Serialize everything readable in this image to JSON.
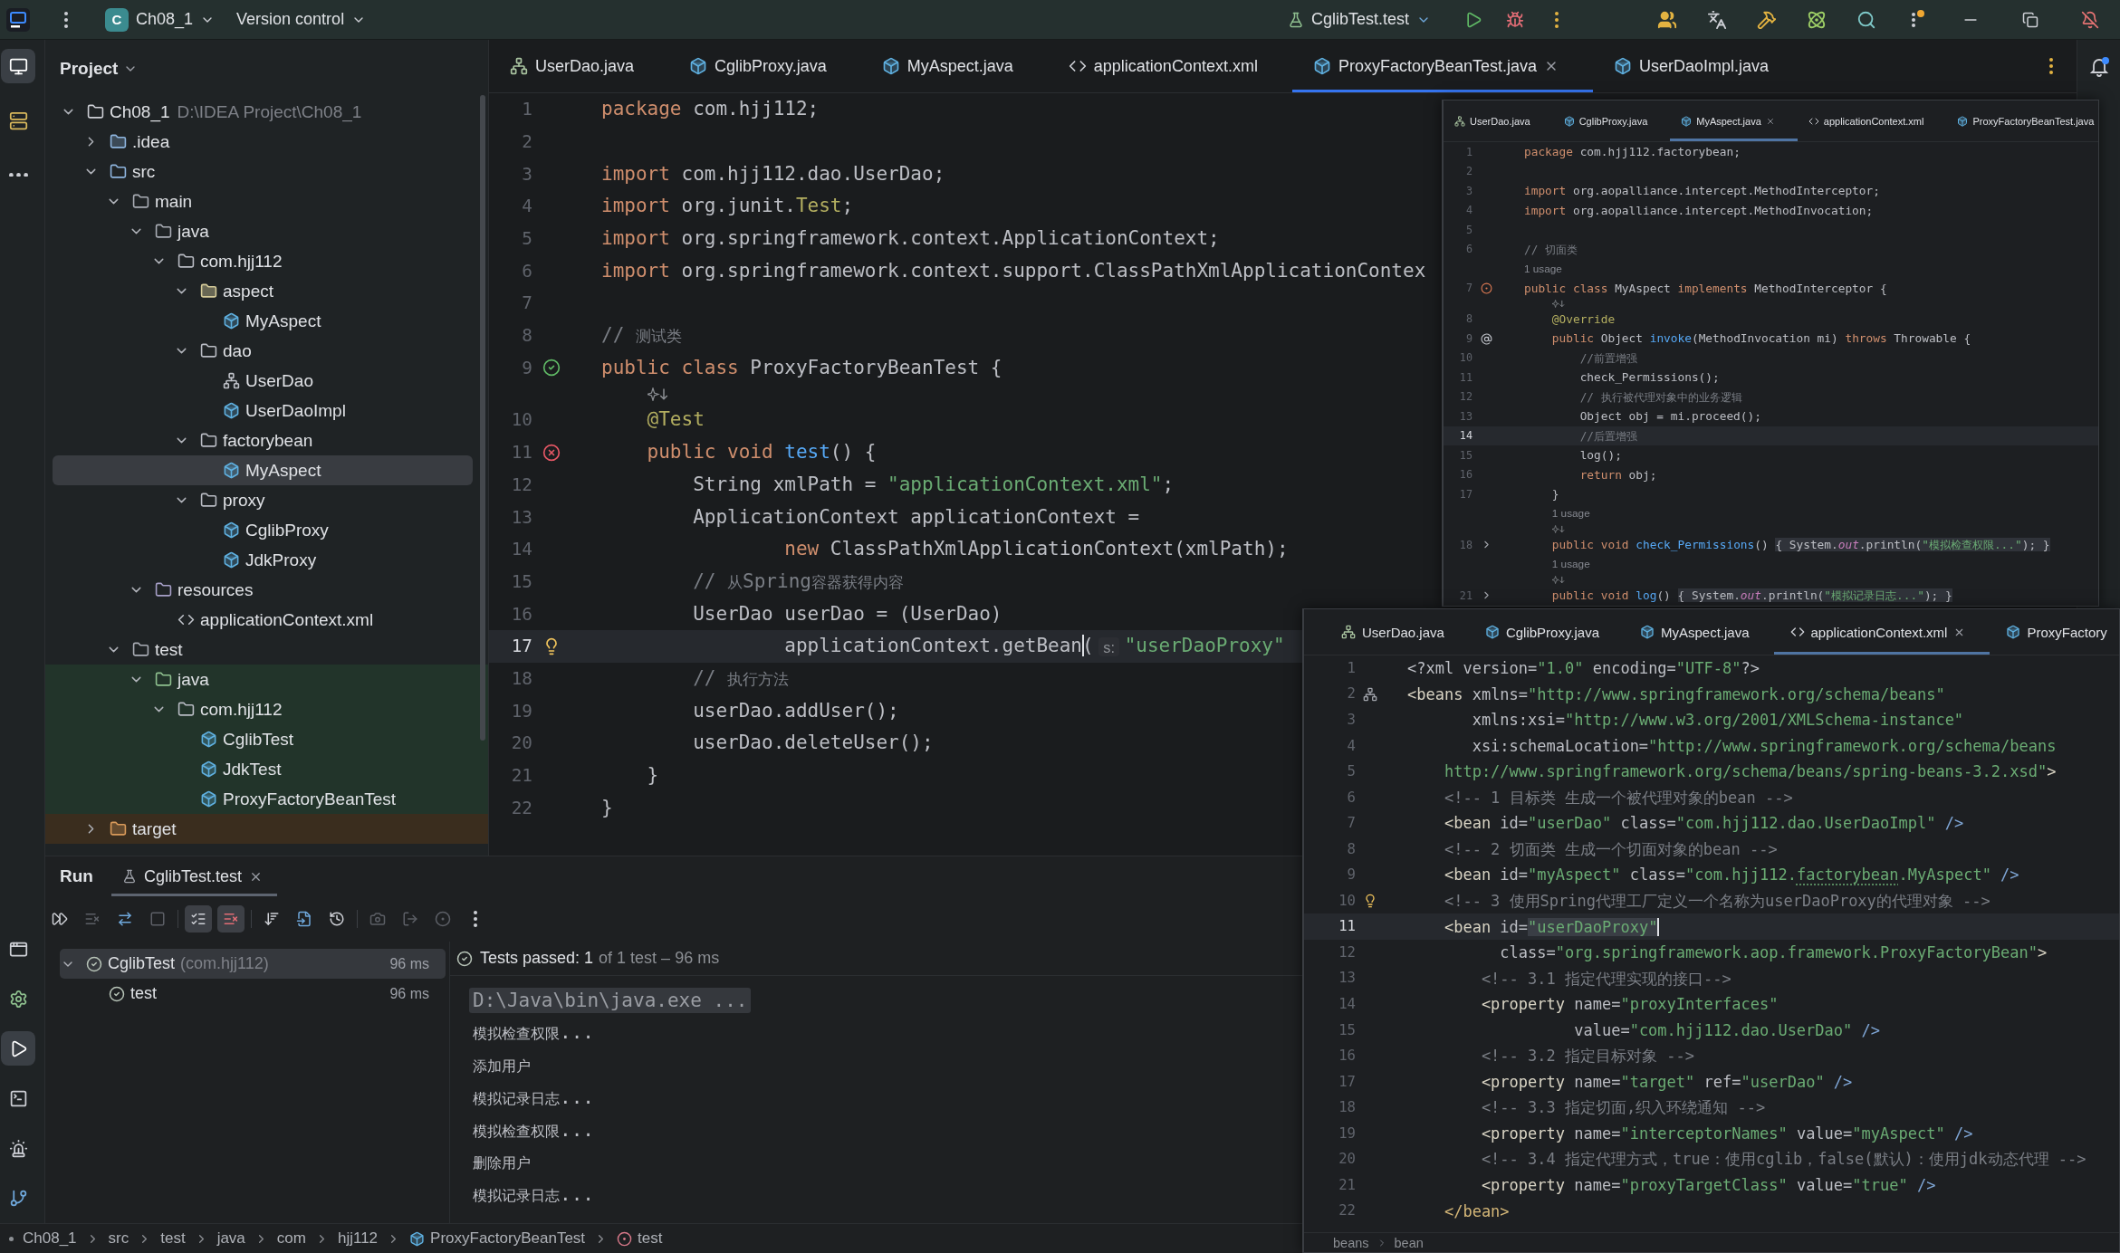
{
  "title_bar": {
    "project_badge": "C",
    "project": "Ch08_1",
    "vcs": "Version control",
    "run_config": "CglibTest.test"
  },
  "tool_strip": {
    "top": [
      {
        "kind": "project",
        "selected": true
      },
      {
        "kind": "structure",
        "selected": false
      },
      {
        "kind": "more",
        "selected": false
      }
    ],
    "bottom": [
      {
        "kind": "layout",
        "selected": false
      },
      {
        "kind": "services",
        "selected": false
      },
      {
        "kind": "run",
        "selected": true
      },
      {
        "kind": "terminal",
        "selected": false
      },
      {
        "kind": "problems",
        "selected": false
      },
      {
        "kind": "git",
        "selected": false
      }
    ]
  },
  "project_panel": {
    "title": "Project",
    "tree": [
      {
        "name": "Ch08_1",
        "kind": "module",
        "path": "D:\\IDEA Project\\Ch08_1",
        "expanded": true,
        "selected": false,
        "children": [
          {
            "name": ".idea",
            "kind": "config_folder",
            "expanded": false,
            "selected": false
          },
          {
            "name": "src",
            "kind": "source_folder",
            "expanded": true,
            "selected": false,
            "children": [
              {
                "name": "main",
                "kind": "folder",
                "expanded": true,
                "selected": false,
                "children": [
                  {
                    "name": "java",
                    "kind": "source_root",
                    "expanded": true,
                    "selected": false,
                    "children": [
                      {
                        "name": "com.hjj112",
                        "kind": "package",
                        "expanded": true,
                        "selected": false,
                        "children": [
                          {
                            "name": "aspect",
                            "kind": "plain_folder",
                            "expanded": true,
                            "selected": false,
                            "children": [
                              {
                                "name": "MyAspect",
                                "kind": "class",
                                "selected": false
                              }
                            ]
                          },
                          {
                            "name": "dao",
                            "kind": "package",
                            "expanded": true,
                            "selected": false,
                            "children": [
                              {
                                "name": "UserDao",
                                "kind": "interface",
                                "selected": false
                              },
                              {
                                "name": "UserDaoImpl",
                                "kind": "class",
                                "selected": false
                              }
                            ]
                          },
                          {
                            "name": "factorybean",
                            "kind": "package",
                            "expanded": true,
                            "selected": false,
                            "children": [
                              {
                                "name": "MyAspect",
                                "kind": "class",
                                "selected": true
                              }
                            ]
                          },
                          {
                            "name": "proxy",
                            "kind": "package",
                            "expanded": true,
                            "selected": false,
                            "children": [
                              {
                                "name": "CglibProxy",
                                "kind": "class",
                                "selected": false
                              },
                              {
                                "name": "JdkProxy",
                                "kind": "class",
                                "selected": false
                              }
                            ]
                          }
                        ]
                      }
                    ]
                  },
                  {
                    "name": "resources",
                    "kind": "resource_root",
                    "expanded": true,
                    "selected": false,
                    "children": [
                      {
                        "name": "applicationContext.xml",
                        "kind": "xml",
                        "selected": false
                      }
                    ]
                  }
                ]
              },
              {
                "name": "test",
                "kind": "folder",
                "expanded": true,
                "selected": false,
                "children": [
                  {
                    "name": "java",
                    "kind": "test_root",
                    "expanded": true,
                    "selected": false,
                    "children": [
                      {
                        "name": "com.hjj112",
                        "kind": "test_package",
                        "expanded": true,
                        "selected": false,
                        "children": [
                          {
                            "name": "CglibTest",
                            "kind": "test_class",
                            "selected": false
                          },
                          {
                            "name": "JdkTest",
                            "kind": "test_class",
                            "selected": false
                          },
                          {
                            "name": "ProxyFactoryBeanTest",
                            "kind": "test_class",
                            "selected": false
                          }
                        ]
                      }
                    ]
                  }
                ]
              }
            ]
          },
          {
            "name": "target",
            "kind": "excluded_folder",
            "expanded": false,
            "selected": false
          }
        ]
      }
    ]
  },
  "editor": {
    "tabs": [
      {
        "label": "UserDao.java",
        "kind": "interface",
        "selected": false
      },
      {
        "label": "CglibProxy.java",
        "kind": "class",
        "selected": false
      },
      {
        "label": "MyAspect.java",
        "kind": "class",
        "selected": false
      },
      {
        "label": "applicationContext.xml",
        "kind": "xml",
        "selected": false
      },
      {
        "label": "ProxyFactoryBeanTest.java",
        "kind": "class",
        "selected": true
      },
      {
        "label": "UserDaoImpl.java",
        "kind": "class",
        "selected": false
      }
    ],
    "lines": [
      {
        "number": "1",
        "current": false,
        "tokens": [
          {
            "kind": "kw",
            "text": "package"
          },
          {
            "kind": "p",
            "text": " com.hjj112;"
          }
        ]
      },
      {
        "number": "2",
        "current": false
      },
      {
        "number": "3",
        "current": false,
        "tokens": [
          {
            "kind": "kw",
            "text": "import"
          },
          {
            "kind": "p",
            "text": " com.hjj112.dao.UserDao;"
          }
        ]
      },
      {
        "number": "4",
        "current": false,
        "tokens": [
          {
            "kind": "kw",
            "text": "import"
          },
          {
            "kind": "p",
            "text": " org.junit."
          },
          {
            "kind": "ann",
            "text": "Test"
          },
          {
            "kind": "p",
            "text": ";"
          }
        ]
      },
      {
        "number": "5",
        "current": false,
        "tokens": [
          {
            "kind": "kw",
            "text": "import"
          },
          {
            "kind": "p",
            "text": " org.springframework.context.ApplicationContext;"
          }
        ]
      },
      {
        "number": "6",
        "current": false,
        "tokens": [
          {
            "kind": "kw",
            "text": "import"
          },
          {
            "kind": "p",
            "text": " org.springframework.context.support.ClassPathXmlApplicationContex"
          }
        ]
      },
      {
        "number": "7",
        "current": false
      },
      {
        "number": "8",
        "current": false,
        "tokens": [
          {
            "kind": "cmt",
            "text": "// 测试类"
          }
        ]
      },
      {
        "number": "9",
        "current": false,
        "marker": {
          "kind": "passed"
        },
        "tokens": [
          {
            "kind": "kw",
            "text": "public class"
          },
          {
            "kind": "p",
            "text": " ProxyFactoryBeanTest {"
          }
        ]
      },
      {
        "number": "10",
        "current": false,
        "above": [
          {
            "kind": "ai"
          }
        ],
        "tokens": [
          {
            "kind": "ann",
            "text": "    @Test"
          }
        ]
      },
      {
        "number": "11",
        "current": false,
        "marker": {
          "kind": "failed"
        },
        "tokens": [
          {
            "kind": "kw",
            "text": "    public void"
          },
          {
            "kind": "fn",
            "text": " test"
          },
          {
            "kind": "p",
            "text": "() {"
          }
        ]
      },
      {
        "number": "12",
        "current": false,
        "tokens": [
          {
            "kind": "p",
            "text": "        String xmlPath = "
          },
          {
            "kind": "str",
            "text": "\"applicationContext.xml\""
          },
          {
            "kind": "p",
            "text": ";"
          }
        ]
      },
      {
        "number": "13",
        "current": false,
        "tokens": [
          {
            "kind": "p",
            "text": "        ApplicationContext applicationContext ="
          }
        ]
      },
      {
        "number": "14",
        "current": false,
        "tokens": [
          {
            "kind": "kw",
            "text": "                new"
          },
          {
            "kind": "p",
            "text": " ClassPathXmlApplicationContext(xmlPath);"
          }
        ]
      },
      {
        "number": "15",
        "current": false,
        "tokens": [
          {
            "kind": "cmt",
            "text": "        // 从Spring容器获得内容"
          }
        ]
      },
      {
        "number": "16",
        "current": false,
        "tokens": [
          {
            "kind": "p",
            "text": "        UserDao userDao = (UserDao)"
          }
        ]
      },
      {
        "number": "17",
        "current": true,
        "marker": {
          "kind": "bulb"
        },
        "tokens": [
          {
            "kind": "p",
            "text": "                applicationContext.getBean"
          },
          {
            "kind": "caret"
          },
          {
            "kind": "p",
            "text": "("
          },
          {
            "kind": "hint",
            "text": "s:"
          },
          {
            "kind": "str",
            "text": "\"userDaoProxy\""
          }
        ]
      },
      {
        "number": "18",
        "current": false,
        "tokens": [
          {
            "kind": "cmt",
            "text": "        // 执行方法"
          }
        ]
      },
      {
        "number": "19",
        "current": false,
        "tokens": [
          {
            "kind": "p",
            "text": "        userDao.addUser();"
          }
        ]
      },
      {
        "number": "20",
        "current": false,
        "tokens": [
          {
            "kind": "p",
            "text": "        userDao.deleteUser();"
          }
        ]
      },
      {
        "number": "21",
        "current": false,
        "tokens": [
          {
            "kind": "p",
            "text": "    }"
          }
        ]
      },
      {
        "number": "22",
        "current": false,
        "tokens": [
          {
            "kind": "p",
            "text": "}"
          }
        ]
      }
    ]
  },
  "overlay_windows": [
    {
      "tabs": [
        {
          "label": "UserDao.java",
          "kind": "interface",
          "selected": false
        },
        {
          "label": "CglibProxy.java",
          "kind": "class",
          "selected": false
        },
        {
          "label": "MyAspect.java",
          "kind": "class",
          "selected": true
        },
        {
          "label": "applicationContext.xml",
          "kind": "xml",
          "selected": false
        },
        {
          "label": "ProxyFactoryBeanTest.java",
          "kind": "class",
          "selected": false
        }
      ],
      "lines": [
        {
          "number": "1",
          "current": false,
          "tokens": [
            {
              "kind": "kw",
              "text": "package"
            },
            {
              "kind": "p",
              "text": " com.hjj112.factorybean;"
            }
          ]
        },
        {
          "number": "2",
          "current": false
        },
        {
          "number": "3",
          "current": false,
          "tokens": [
            {
              "kind": "kw",
              "text": "import"
            },
            {
              "kind": "p",
              "text": " org.aopalliance.intercept.MethodInterceptor;"
            }
          ]
        },
        {
          "number": "4",
          "current": false,
          "tokens": [
            {
              "kind": "kw",
              "text": "import"
            },
            {
              "kind": "p",
              "text": " org.aopalliance.intercept.MethodInvocation;"
            }
          ]
        },
        {
          "number": "5",
          "current": false
        },
        {
          "number": "6",
          "current": false,
          "tokens": [
            {
              "kind": "cmt",
              "text": "// 切面类"
            }
          ]
        },
        {
          "number": "7",
          "current": false,
          "marker": {
            "kind": "implements"
          },
          "above": [
            {
              "kind": "usage",
              "text": "1 usage"
            }
          ],
          "tokens": [
            {
              "kind": "kw",
              "text": "public class"
            },
            {
              "kind": "p",
              "text": " MyAspect "
            },
            {
              "kind": "kw",
              "text": "implements"
            },
            {
              "kind": "p",
              "text": " MethodInterceptor {"
            }
          ]
        },
        {
          "number": "8",
          "current": false,
          "above": [
            {
              "kind": "ai"
            }
          ],
          "tokens": [
            {
              "kind": "ann",
              "text": "    @Override"
            }
          ]
        },
        {
          "number": "9",
          "current": false,
          "marker": {
            "kind": "override"
          },
          "tokens": [
            {
              "kind": "kw",
              "text": "    public"
            },
            {
              "kind": "p",
              "text": " Object "
            },
            {
              "kind": "fn",
              "text": "invoke"
            },
            {
              "kind": "p",
              "text": "(MethodInvocation mi) "
            },
            {
              "kind": "kw",
              "text": "throws"
            },
            {
              "kind": "p",
              "text": " Throwable {"
            }
          ]
        },
        {
          "number": "10",
          "current": false,
          "tokens": [
            {
              "kind": "cmt",
              "text": "        //前置增强"
            }
          ]
        },
        {
          "number": "11",
          "current": false,
          "tokens": [
            {
              "kind": "p",
              "text": "        check_Permissions();"
            }
          ]
        },
        {
          "number": "12",
          "current": false,
          "tokens": [
            {
              "kind": "cmt",
              "text": "        // 执行被代理对象中的业务逻辑"
            }
          ]
        },
        {
          "number": "13",
          "current": false,
          "tokens": [
            {
              "kind": "p",
              "text": "        Object obj = mi.proceed();"
            }
          ]
        },
        {
          "number": "14",
          "current": true,
          "tokens": [
            {
              "kind": "cmt",
              "text": "        //后置增强"
            }
          ]
        },
        {
          "number": "15",
          "current": false,
          "tokens": [
            {
              "kind": "p",
              "text": "        log();"
            }
          ]
        },
        {
          "number": "16",
          "current": false,
          "tokens": [
            {
              "kind": "kw",
              "text": "        return"
            },
            {
              "kind": "p",
              "text": " obj;"
            }
          ]
        },
        {
          "number": "17",
          "current": false,
          "tokens": [
            {
              "kind": "p",
              "text": "    }"
            }
          ]
        },
        {
          "number": "18",
          "current": false,
          "marker": {
            "kind": "fold"
          },
          "above": [
            {
              "kind": "usage",
              "text": "1 usage"
            },
            {
              "kind": "ai"
            }
          ],
          "tokens": [
            {
              "kind": "kw",
              "text": "    public void"
            },
            {
              "kind": "fn",
              "text": " check_Permissions"
            },
            {
              "kind": "p",
              "text": "() "
            },
            {
              "kind": "fp",
              "text": "{ System."
            },
            {
              "kind": "fst",
              "text": "out"
            },
            {
              "kind": "fp",
              "text": ".println("
            },
            {
              "kind": "fstr",
              "text": "\"模拟检查权限...\""
            },
            {
              "kind": "fp",
              "text": "); }"
            }
          ]
        },
        {
          "number": "21",
          "current": false,
          "marker": {
            "kind": "fold"
          },
          "above": [
            {
              "kind": "usage",
              "text": "1 usage"
            },
            {
              "kind": "ai"
            }
          ],
          "tokens": [
            {
              "kind": "kw",
              "text": "    public void"
            },
            {
              "kind": "fn",
              "text": " log"
            },
            {
              "kind": "p",
              "text": "() "
            },
            {
              "kind": "fp",
              "text": "{ System."
            },
            {
              "kind": "fst",
              "text": "out"
            },
            {
              "kind": "fp",
              "text": ".println("
            },
            {
              "kind": "fstr",
              "text": "\"模拟记录日志...\""
            },
            {
              "kind": "fp",
              "text": "); }"
            }
          ]
        }
      ]
    },
    {
      "tabs": [
        {
          "label": "UserDao.java",
          "kind": "interface",
          "selected": false
        },
        {
          "label": "CglibProxy.java",
          "kind": "class",
          "selected": false
        },
        {
          "label": "MyAspect.java",
          "kind": "class",
          "selected": false
        },
        {
          "label": "applicationContext.xml",
          "kind": "xml",
          "selected": true
        },
        {
          "label": "ProxyFactory",
          "kind": "class",
          "selected": false
        }
      ],
      "lines": [
        {
          "number": "1",
          "current": false,
          "tokens": [
            {
              "kind": "p",
              "text": "<?xml version="
            },
            {
              "kind": "str",
              "text": "\"1.0\""
            },
            {
              "kind": "p",
              "text": " encoding="
            },
            {
              "kind": "str",
              "text": "\"UTF-8\""
            },
            {
              "kind": "p",
              "text": "?>"
            }
          ]
        },
        {
          "number": "2",
          "current": false,
          "marker": {
            "kind": "structure"
          },
          "tokens": [
            {
              "kind": "tag",
              "text": "<beans"
            },
            {
              "kind": "attr",
              "text": " xmlns="
            },
            {
              "kind": "val",
              "text": "\"http://www.springframework.org/schema/beans\""
            }
          ]
        },
        {
          "number": "3",
          "current": false,
          "tokens": [
            {
              "kind": "attr",
              "text": "       xmlns:xsi="
            },
            {
              "kind": "val",
              "text": "\"http://www.w3.org/2001/XMLSchema-instance\""
            }
          ]
        },
        {
          "number": "4",
          "current": false,
          "tokens": [
            {
              "kind": "attr",
              "text": "       xsi:schemaLocation="
            },
            {
              "kind": "val",
              "text": "\"http://www.springframework.org/schema/beans"
            }
          ]
        },
        {
          "number": "5",
          "current": false,
          "tokens": [
            {
              "kind": "val",
              "text": "    http://www.springframework.org/schema/beans/spring-beans-3.2.xsd\""
            },
            {
              "kind": "tag",
              "text": ">"
            }
          ]
        },
        {
          "number": "6",
          "current": false,
          "tokens": [
            {
              "kind": "cmt",
              "text": "    <!-- 1 目标类 生成一个被代理对象的bean -->"
            }
          ]
        },
        {
          "number": "7",
          "current": false,
          "tokens": [
            {
              "kind": "tag",
              "text": "    <bean"
            },
            {
              "kind": "attr",
              "text": " id="
            },
            {
              "kind": "val",
              "text": "\"userDao\""
            },
            {
              "kind": "attr",
              "text": " class="
            },
            {
              "kind": "val",
              "text": "\"com.hjj112.dao.UserDaoImpl\""
            },
            {
              "kind": "tagend",
              "text": " />"
            }
          ]
        },
        {
          "number": "8",
          "current": false,
          "tokens": [
            {
              "kind": "cmt",
              "text": "    <!-- 2 切面类 生成一个切面对象的bean -->"
            }
          ]
        },
        {
          "number": "9",
          "current": false,
          "tokens": [
            {
              "kind": "tag",
              "text": "    <bean"
            },
            {
              "kind": "attr",
              "text": " id="
            },
            {
              "kind": "val",
              "text": "\"myAspect\""
            },
            {
              "kind": "attr",
              "text": " class="
            },
            {
              "kind": "val",
              "text": "\"com.hjj112."
            },
            {
              "kind": "typo",
              "text": "factorybean"
            },
            {
              "kind": "val",
              "text": ".MyAspect\""
            },
            {
              "kind": "tagend",
              "text": " />"
            }
          ]
        },
        {
          "number": "10",
          "current": false,
          "marker": {
            "kind": "bulb"
          },
          "tokens": [
            {
              "kind": "cmt",
              "text": "    <!-- 3 使用Spring代理工厂定义一个名称为userDaoProxy的代理对象 -->"
            }
          ]
        },
        {
          "number": "11",
          "current": true,
          "tokens": [
            {
              "kind": "tag",
              "text": "    <bean"
            },
            {
              "kind": "attr",
              "text": " id="
            },
            {
              "kind": "valsel",
              "text": "\"userDaoProxy\""
            },
            {
              "kind": "caret"
            }
          ]
        },
        {
          "number": "12",
          "current": false,
          "tokens": [
            {
              "kind": "attr",
              "text": "          class="
            },
            {
              "kind": "val",
              "text": "\"org.springframework.aop.framework.ProxyFactoryBean\""
            },
            {
              "kind": "tag",
              "text": ">"
            }
          ]
        },
        {
          "number": "13",
          "current": false,
          "tokens": [
            {
              "kind": "cmt",
              "text": "        <!-- 3.1 指定代理实现的接口-->"
            }
          ]
        },
        {
          "number": "14",
          "current": false,
          "tokens": [
            {
              "kind": "tag",
              "text": "        <property"
            },
            {
              "kind": "attr",
              "text": " name="
            },
            {
              "kind": "val",
              "text": "\"proxyInterfaces\""
            }
          ]
        },
        {
          "number": "15",
          "current": false,
          "tokens": [
            {
              "kind": "attr",
              "text": "                  value="
            },
            {
              "kind": "val",
              "text": "\"com.hjj112.dao.UserDao\""
            },
            {
              "kind": "tagend",
              "text": " />"
            }
          ]
        },
        {
          "number": "16",
          "current": false,
          "tokens": [
            {
              "kind": "cmt",
              "text": "        <!-- 3.2 指定目标对象 -->"
            }
          ]
        },
        {
          "number": "17",
          "current": false,
          "tokens": [
            {
              "kind": "tag",
              "text": "        <property"
            },
            {
              "kind": "attr",
              "text": " name="
            },
            {
              "kind": "val",
              "text": "\"target\""
            },
            {
              "kind": "attr",
              "text": " ref="
            },
            {
              "kind": "val",
              "text": "\"userDao\""
            },
            {
              "kind": "tagend",
              "text": " />"
            }
          ]
        },
        {
          "number": "18",
          "current": false,
          "tokens": [
            {
              "kind": "cmt",
              "text": "        <!-- 3.3 指定切面,织入环绕通知 -->"
            }
          ]
        },
        {
          "number": "19",
          "current": false,
          "tokens": [
            {
              "kind": "tag",
              "text": "        <property"
            },
            {
              "kind": "attr",
              "text": " name="
            },
            {
              "kind": "val",
              "text": "\"interceptorNames\""
            },
            {
              "kind": "attr",
              "text": " value="
            },
            {
              "kind": "val",
              "text": "\"myAspect\""
            },
            {
              "kind": "tagend",
              "text": " />"
            }
          ]
        },
        {
          "number": "20",
          "current": false,
          "tokens": [
            {
              "kind": "cmt",
              "text": "        <!-- 3.4 指定代理方式，true：使用cglib，false(默认)：使用jdk动态代理 -->"
            }
          ]
        },
        {
          "number": "21",
          "current": false,
          "tokens": [
            {
              "kind": "tag",
              "text": "        <property"
            },
            {
              "kind": "attr",
              "text": " name="
            },
            {
              "kind": "val",
              "text": "\"proxyTargetClass\""
            },
            {
              "kind": "attr",
              "text": " value="
            },
            {
              "kind": "val",
              "text": "\"true\""
            },
            {
              "kind": "tagend",
              "text": " />"
            }
          ]
        },
        {
          "number": "22",
          "current": false,
          "tokens": [
            {
              "kind": "tagm",
              "text": "    </bean>"
            }
          ]
        }
      ],
      "breadcrumbs": [
        {
          "label": "beans"
        },
        {
          "label": "bean"
        }
      ]
    }
  ],
  "run_panel": {
    "title": "Run",
    "tabs": [
      {
        "label": "CglibTest.test",
        "selected": true
      }
    ],
    "toolbar_groups": [
      [
        {
          "kind": "rerun",
          "disabled": false,
          "on": false
        },
        {
          "kind": "rerun_failed",
          "disabled": true,
          "on": false
        },
        {
          "kind": "auto_test",
          "disabled": false,
          "on": false
        },
        {
          "kind": "stop",
          "disabled": true,
          "on": false
        }
      ],
      [
        {
          "kind": "show_passed",
          "disabled": false,
          "on": true
        },
        {
          "kind": "show_ignored",
          "disabled": false,
          "on": true
        }
      ],
      [
        {
          "kind": "sort",
          "disabled": false,
          "on": false
        },
        {
          "kind": "import",
          "disabled": false,
          "on": false
        },
        {
          "kind": "history",
          "disabled": false,
          "on": false
        }
      ],
      [
        {
          "kind": "snapshot",
          "disabled": true,
          "on": false
        },
        {
          "kind": "export",
          "disabled": true,
          "on": false
        },
        {
          "kind": "coverage",
          "disabled": true,
          "on": false
        },
        {
          "kind": "more",
          "disabled": false,
          "on": false
        }
      ]
    ],
    "tests": [
      {
        "name": "CglibTest",
        "package": "(com.hjj112)",
        "time": "96 ms",
        "passed": true,
        "expanded": true,
        "selected": true,
        "children": [
          {
            "name": "test",
            "time": "96 ms",
            "passed": true,
            "selected": false
          }
        ]
      }
    ],
    "summary": {
      "status": "Tests passed: 1",
      "detail": "of 1 test – 96 ms"
    },
    "console": [
      {
        "kind": "command",
        "text": "D:\\Java\\bin\\java.exe ..."
      },
      {
        "kind": "output",
        "text": "模拟检查权限..."
      },
      {
        "kind": "output",
        "text": "添加用户"
      },
      {
        "kind": "output",
        "text": "模拟记录日志..."
      },
      {
        "kind": "output",
        "text": "模拟检查权限..."
      },
      {
        "kind": "output",
        "text": "删除用户"
      },
      {
        "kind": "output",
        "text": "模拟记录日志..."
      }
    ]
  },
  "status_bar": {
    "breadcrumbs": [
      {
        "kind": "folder",
        "label": "Ch08_1"
      },
      {
        "kind": "folder",
        "label": "src"
      },
      {
        "kind": "folder",
        "label": "test"
      },
      {
        "kind": "folder",
        "label": "java"
      },
      {
        "kind": "folder",
        "label": "com"
      },
      {
        "kind": "folder",
        "label": "hjj112"
      },
      {
        "kind": "class",
        "label": "ProxyFactoryBeanTest"
      },
      {
        "kind": "method",
        "label": "test"
      }
    ]
  }
}
